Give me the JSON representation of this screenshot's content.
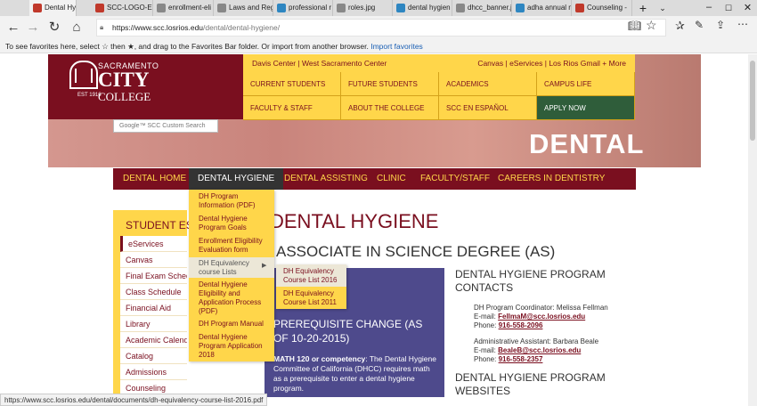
{
  "browser": {
    "tabs": [
      {
        "label": "Dental Hy",
        "fav_color": "#c0392b"
      },
      {
        "label": "SCC-LOGO-E",
        "fav_color": "#c0392b"
      },
      {
        "label": "enrollment-eli",
        "fav_color": "#888888"
      },
      {
        "label": "Laws and Regu",
        "fav_color": "#888888"
      },
      {
        "label": "professional r",
        "fav_color": "#2e86c1"
      },
      {
        "label": "roles.jpg",
        "fav_color": "#888888"
      },
      {
        "label": "dental hygien",
        "fav_color": "#2e86c1"
      },
      {
        "label": "dhcc_banner.j",
        "fav_color": "#888888"
      },
      {
        "label": "adha annual m",
        "fav_color": "#2e86c1"
      },
      {
        "label": "Counseling -",
        "fav_color": "#c0392b"
      }
    ],
    "url_host": "https://www.scc.losrios.edu",
    "url_path": "/dental/dental-hygiene/",
    "favbar_text": "To see favorites here, select ☆ then ★, and drag to the Favorites Bar folder. Or import from another browser.",
    "favbar_link": "Import favorites",
    "status_url": "https://www.scc.losrios.edu/dental/documents/dh-equivalency-course-list-2016.pdf"
  },
  "site": {
    "logo_line1": "SACRAMENTO",
    "logo_line2": "CITY",
    "logo_line3": "COLLEGE",
    "logo_est": "EST 1916",
    "search_placeholder": "Google™ SCC Custom Search",
    "top_left": "Davis Center  |  West Sacramento Center",
    "top_right": "Canvas  |  eServices  |  Los Rios Gmail + More",
    "audience": [
      "CURRENT STUDENTS",
      "FUTURE STUDENTS",
      "ACADEMICS",
      "CAMPUS LIFE",
      "FACULTY & STAFF",
      "ABOUT THE COLLEGE",
      "SCC EN ESPAÑOL",
      "APPLY NOW"
    ],
    "hero_title": "DENTAL",
    "mainnav": [
      "DENTAL HOME",
      "DENTAL HYGIENE",
      "DENTAL ASSISTING",
      "CLINIC",
      "FACULTY/STAFF",
      "CAREERS IN DENTISTRY"
    ]
  },
  "sidebar": {
    "heading": "STUDENT ESS",
    "items": [
      "eServices",
      "Canvas",
      "Final Exam Schedule",
      "Class Schedule",
      "Financial Aid",
      "Library",
      "Academic Calendar",
      "Catalog",
      "Admissions",
      "Counseling"
    ]
  },
  "dropdown": {
    "items": [
      "DH Program Information (PDF)",
      "Dental Hygiene Program Goals",
      "Enrollment Eligibility Evaluation form",
      "DH Equivalency course Lists",
      "Dental Hygiene Eligibility and Application Process (PDF)",
      "DH Program Manual",
      "Dental Hygiene Program Application 2018"
    ],
    "sub_items": [
      "DH Equivalency Course List 2016",
      "DH Equivalency Course List 2011"
    ]
  },
  "content": {
    "h1": "DENTAL HYGIENE",
    "h2": "ASSOCIATE IN SCIENCE DEGREE (AS)",
    "notice_heading": "PREREQUISITE CHANGE (AS OF 10-20-2015)",
    "notice_strong": "MATH 120 or competency",
    "notice_text": ": The Dental Hygiene Committee of California (DHCC) requires math as a prerequisite to enter a dental hygiene program.",
    "contacts_heading": "DENTAL HYGIENE PROGRAM CONTACTS",
    "contact1_role": "DH Program Coordinator: Melissa Fellman",
    "contact1_email_label": "E-mail: ",
    "contact1_email": "FellmaM@scc.losrios.edu",
    "contact1_phone_label": "Phone: ",
    "contact1_phone": "916-558-2096",
    "contact2_role": "Administrative Assistant: Barbara Beale",
    "contact2_email_label": "E-mail: ",
    "contact2_email": "BealeB@scc.losrios.edu",
    "contact2_phone_label": "Phone: ",
    "contact2_phone": "916-558-2357",
    "websites_heading": "DENTAL HYGIENE PROGRAM WEBSITES"
  }
}
